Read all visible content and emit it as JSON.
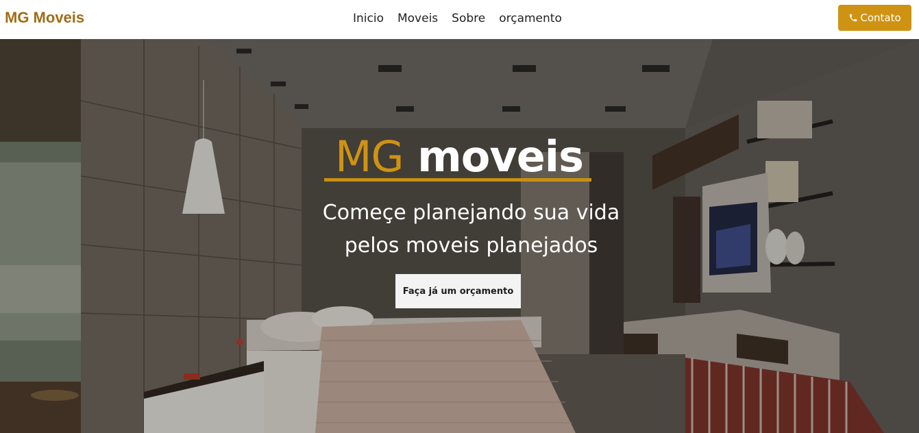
{
  "navbar": {
    "brand": "MG Moveis",
    "links": [
      "Inicio",
      "Moveis",
      "Sobre",
      "orçamento"
    ],
    "contact_label": "Contato",
    "accent_color": "#cf9313"
  },
  "hero": {
    "title_mg": "MG",
    "title_moveis": " moveis",
    "subtitle_line1": "Começe planejando sua vida",
    "subtitle_line2": "pelos moveis planejados",
    "cta_label": "Faça já um orçamento",
    "background": "bedroom-photo"
  }
}
